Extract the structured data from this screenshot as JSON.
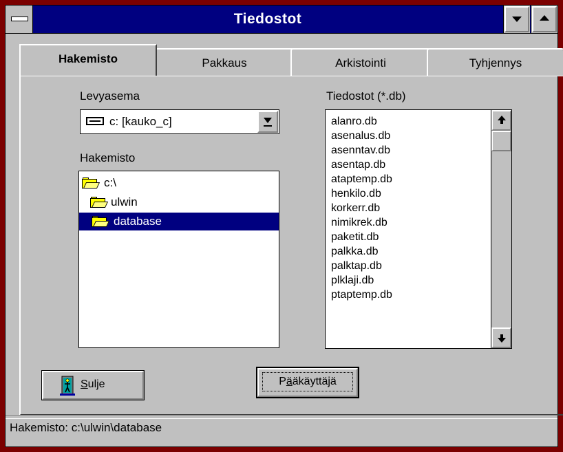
{
  "window": {
    "title": "Tiedostot"
  },
  "tabs": [
    {
      "label": "Hakemisto",
      "active": true
    },
    {
      "label": "Pakkaus",
      "active": false
    },
    {
      "label": "Arkistointi",
      "active": false
    },
    {
      "label": "Tyhjennys",
      "active": false
    }
  ],
  "drive": {
    "label": "Levyasema",
    "value": "c: [kauko_c]",
    "icon": "hard-drive-icon"
  },
  "directory": {
    "label": "Hakemisto",
    "tree": [
      {
        "name": "c:\\",
        "icon": "open-folder-icon",
        "selected": false
      },
      {
        "name": "ulwin",
        "icon": "open-folder-icon",
        "selected": false
      },
      {
        "name": "database",
        "icon": "open-folder-icon",
        "selected": true
      }
    ]
  },
  "files": {
    "label": "Tiedostot (*.db)",
    "items": [
      "alanro.db",
      "asenalus.db",
      "asenntav.db",
      "asentap.db",
      "ataptemp.db",
      "henkilo.db",
      "korkerr.db",
      "nimikrek.db",
      "paketit.db",
      "palkka.db",
      "palktap.db",
      "plklaji.db",
      "ptaptemp.db"
    ]
  },
  "buttons": {
    "close": {
      "label": "Sulje",
      "mnemonic": "S",
      "rest": "ulje",
      "icon": "exit-door-icon"
    },
    "admin": {
      "label": "Pääkäyttäjä",
      "pre": "P",
      "mnemonic": "ä",
      "rest": "äkäyttäjä"
    }
  },
  "status": {
    "text": "Hakemisto: c:\\ulwin\\database"
  },
  "colors": {
    "titlebar": "#000080",
    "face": "#c0c0c0",
    "border": "#7b0000",
    "folder": "#ffff00"
  }
}
